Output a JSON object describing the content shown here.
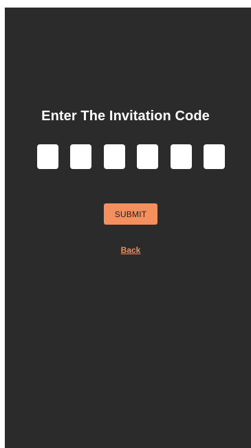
{
  "heading": "Enter The Invitation Code",
  "code_inputs": [
    "",
    "",
    "",
    "",
    "",
    ""
  ],
  "submit_label": "SUBMIT",
  "back_label": "Back",
  "colors": {
    "background": "#2b2b2b",
    "accent": "#f4905e",
    "input_background": "#ffffff",
    "heading_text": "#ffffff"
  }
}
